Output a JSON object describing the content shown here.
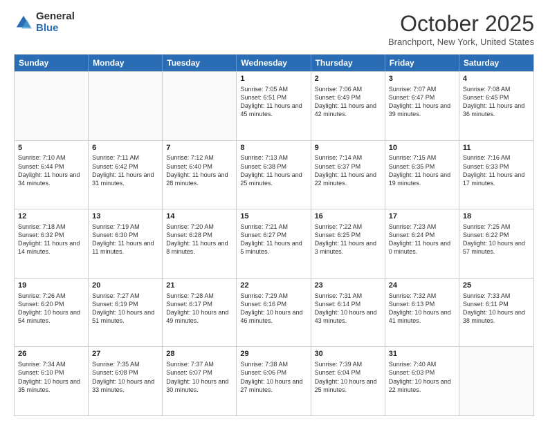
{
  "logo": {
    "general": "General",
    "blue": "Blue"
  },
  "title": {
    "month": "October 2025",
    "location": "Branchport, New York, United States"
  },
  "days_of_week": [
    "Sunday",
    "Monday",
    "Tuesday",
    "Wednesday",
    "Thursday",
    "Friday",
    "Saturday"
  ],
  "weeks": [
    [
      {
        "day": "",
        "info": ""
      },
      {
        "day": "",
        "info": ""
      },
      {
        "day": "",
        "info": ""
      },
      {
        "day": "1",
        "info": "Sunrise: 7:05 AM\nSunset: 6:51 PM\nDaylight: 11 hours and 45 minutes."
      },
      {
        "day": "2",
        "info": "Sunrise: 7:06 AM\nSunset: 6:49 PM\nDaylight: 11 hours and 42 minutes."
      },
      {
        "day": "3",
        "info": "Sunrise: 7:07 AM\nSunset: 6:47 PM\nDaylight: 11 hours and 39 minutes."
      },
      {
        "day": "4",
        "info": "Sunrise: 7:08 AM\nSunset: 6:45 PM\nDaylight: 11 hours and 36 minutes."
      }
    ],
    [
      {
        "day": "5",
        "info": "Sunrise: 7:10 AM\nSunset: 6:44 PM\nDaylight: 11 hours and 34 minutes."
      },
      {
        "day": "6",
        "info": "Sunrise: 7:11 AM\nSunset: 6:42 PM\nDaylight: 11 hours and 31 minutes."
      },
      {
        "day": "7",
        "info": "Sunrise: 7:12 AM\nSunset: 6:40 PM\nDaylight: 11 hours and 28 minutes."
      },
      {
        "day": "8",
        "info": "Sunrise: 7:13 AM\nSunset: 6:38 PM\nDaylight: 11 hours and 25 minutes."
      },
      {
        "day": "9",
        "info": "Sunrise: 7:14 AM\nSunset: 6:37 PM\nDaylight: 11 hours and 22 minutes."
      },
      {
        "day": "10",
        "info": "Sunrise: 7:15 AM\nSunset: 6:35 PM\nDaylight: 11 hours and 19 minutes."
      },
      {
        "day": "11",
        "info": "Sunrise: 7:16 AM\nSunset: 6:33 PM\nDaylight: 11 hours and 17 minutes."
      }
    ],
    [
      {
        "day": "12",
        "info": "Sunrise: 7:18 AM\nSunset: 6:32 PM\nDaylight: 11 hours and 14 minutes."
      },
      {
        "day": "13",
        "info": "Sunrise: 7:19 AM\nSunset: 6:30 PM\nDaylight: 11 hours and 11 minutes."
      },
      {
        "day": "14",
        "info": "Sunrise: 7:20 AM\nSunset: 6:28 PM\nDaylight: 11 hours and 8 minutes."
      },
      {
        "day": "15",
        "info": "Sunrise: 7:21 AM\nSunset: 6:27 PM\nDaylight: 11 hours and 5 minutes."
      },
      {
        "day": "16",
        "info": "Sunrise: 7:22 AM\nSunset: 6:25 PM\nDaylight: 11 hours and 3 minutes."
      },
      {
        "day": "17",
        "info": "Sunrise: 7:23 AM\nSunset: 6:24 PM\nDaylight: 11 hours and 0 minutes."
      },
      {
        "day": "18",
        "info": "Sunrise: 7:25 AM\nSunset: 6:22 PM\nDaylight: 10 hours and 57 minutes."
      }
    ],
    [
      {
        "day": "19",
        "info": "Sunrise: 7:26 AM\nSunset: 6:20 PM\nDaylight: 10 hours and 54 minutes."
      },
      {
        "day": "20",
        "info": "Sunrise: 7:27 AM\nSunset: 6:19 PM\nDaylight: 10 hours and 51 minutes."
      },
      {
        "day": "21",
        "info": "Sunrise: 7:28 AM\nSunset: 6:17 PM\nDaylight: 10 hours and 49 minutes."
      },
      {
        "day": "22",
        "info": "Sunrise: 7:29 AM\nSunset: 6:16 PM\nDaylight: 10 hours and 46 minutes."
      },
      {
        "day": "23",
        "info": "Sunrise: 7:31 AM\nSunset: 6:14 PM\nDaylight: 10 hours and 43 minutes."
      },
      {
        "day": "24",
        "info": "Sunrise: 7:32 AM\nSunset: 6:13 PM\nDaylight: 10 hours and 41 minutes."
      },
      {
        "day": "25",
        "info": "Sunrise: 7:33 AM\nSunset: 6:11 PM\nDaylight: 10 hours and 38 minutes."
      }
    ],
    [
      {
        "day": "26",
        "info": "Sunrise: 7:34 AM\nSunset: 6:10 PM\nDaylight: 10 hours and 35 minutes."
      },
      {
        "day": "27",
        "info": "Sunrise: 7:35 AM\nSunset: 6:08 PM\nDaylight: 10 hours and 33 minutes."
      },
      {
        "day": "28",
        "info": "Sunrise: 7:37 AM\nSunset: 6:07 PM\nDaylight: 10 hours and 30 minutes."
      },
      {
        "day": "29",
        "info": "Sunrise: 7:38 AM\nSunset: 6:06 PM\nDaylight: 10 hours and 27 minutes."
      },
      {
        "day": "30",
        "info": "Sunrise: 7:39 AM\nSunset: 6:04 PM\nDaylight: 10 hours and 25 minutes."
      },
      {
        "day": "31",
        "info": "Sunrise: 7:40 AM\nSunset: 6:03 PM\nDaylight: 10 hours and 22 minutes."
      },
      {
        "day": "",
        "info": ""
      }
    ]
  ]
}
